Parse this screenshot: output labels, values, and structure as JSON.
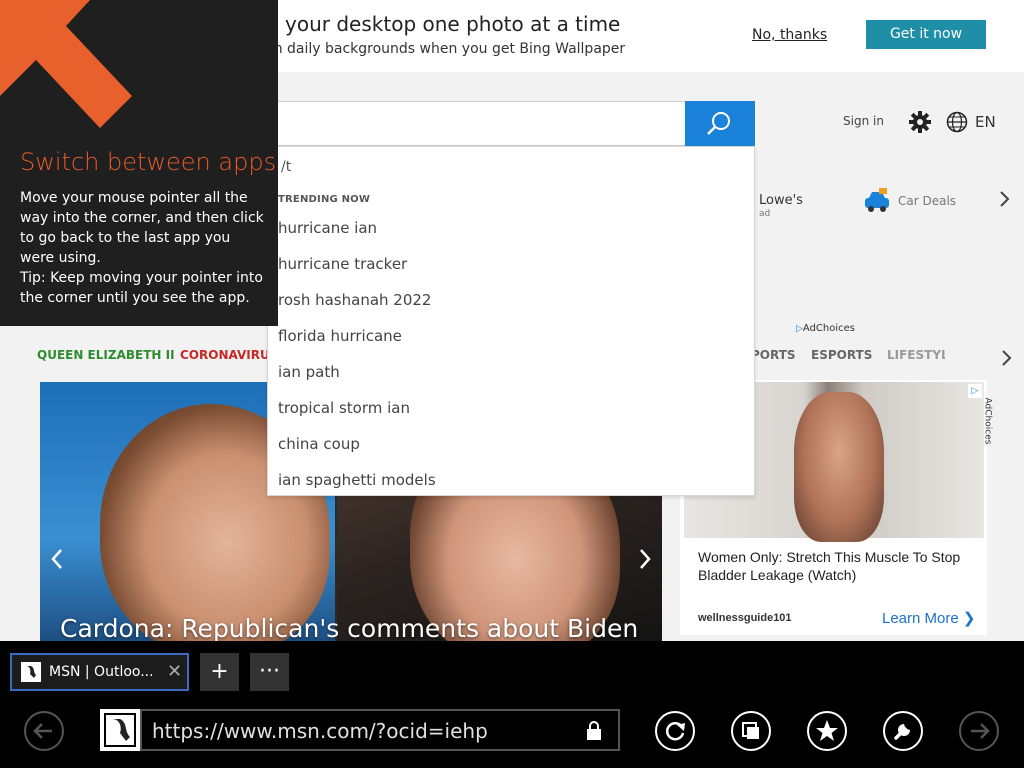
{
  "banner": {
    "title": "n your desktop one photo at a time",
    "subtitle": "ch daily backgrounds when you get Bing Wallpaper",
    "no_thanks": "No, thanks",
    "get_it": "Get it now"
  },
  "header": {
    "signin": "Sign in",
    "language": "EN",
    "search_icon": "search-icon",
    "settings_icon": "gear-icon",
    "language_icon": "globe-icon"
  },
  "suggestions": {
    "typed": "/t",
    "heading": "TRENDING NOW",
    "items": [
      "hurricane ian",
      "hurricane tracker",
      "rosh hashanah 2022",
      "florida hurricane",
      "ian path",
      "tropical storm ian",
      "china coup",
      "ian spaghetti models"
    ]
  },
  "quicklinks": {
    "lowes": "Lowe's",
    "lowes_ad": "ad",
    "car": "Car Deals"
  },
  "adchoices": "AdChoices",
  "nav": {
    "items": [
      "QUEEN ELIZABETH II",
      "CORONAVIRUS",
      "PORTS",
      "ESPORTS",
      "LIFESTYLE"
    ],
    "colors": [
      "#2e8b2e",
      "#c62828",
      "#666666",
      "#666666",
      "#999999"
    ]
  },
  "hero": {
    "caption": "Cardona: Republican's comments about Biden"
  },
  "ad": {
    "headline": "Women Only: Stretch This Muscle To Stop Bladder Leakage (Watch)",
    "source": "wellnessguide101",
    "cta": "Learn More ❯"
  },
  "tip": {
    "title": "Switch between apps",
    "body": "Move your mouse pointer all the way into the corner, and then click to go back to the last app you were using.",
    "hint": "Tip: Keep moving your pointer into the corner until you see the app."
  },
  "appbar": {
    "tab_title": "MSN | Outloo...",
    "tab_close": "✕",
    "new_tab": "+",
    "more": "···",
    "url": "https://www.msn.com/?ocid=iehp",
    "accent": "#3a6cc4"
  }
}
